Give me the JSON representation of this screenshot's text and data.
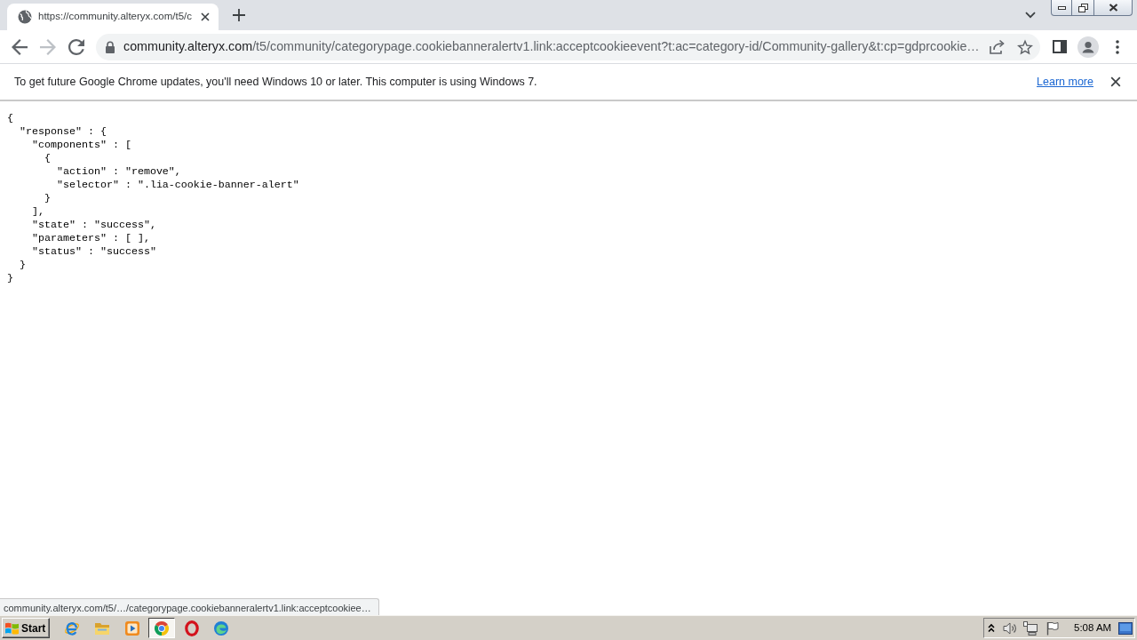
{
  "tabs": [
    {
      "title": "https://community.alteryx.com/t5/c",
      "selected": true
    }
  ],
  "nav_buttons": [
    {
      "kind": "back",
      "disabled": false
    },
    {
      "kind": "forward",
      "disabled": true
    },
    {
      "kind": "reload",
      "disabled": false
    }
  ],
  "address_bar": {
    "host": "community.alteryx.com",
    "path": "/t5/community/categorypage.cookiebanneralertv1.link:acceptcookieevent?t:ac=category-id/Community-gallery&t:cp=gdprcookie…"
  },
  "infobar": {
    "message": "To get future Google Chrome updates, you'll need Windows 10 or later. This computer is using Windows 7.",
    "link": "Learn more"
  },
  "page": {
    "text": "{\n  \"response\" : {\n    \"components\" : [\n      {\n        \"action\" : \"remove\",\n        \"selector\" : \".lia-cookie-banner-alert\"\n      }\n    ],\n    \"state\" : \"success\",\n    \"parameters\" : [ ],\n    \"status\" : \"success\"\n  }\n}"
  },
  "status_bubble": {
    "text": "community.alteryx.com/t5/…/categorypage.cookiebanneralertv1.link:acceptcookiee…"
  },
  "taskbar": {
    "start_label": "Start",
    "apps": [
      {
        "kind": "ie",
        "active": false
      },
      {
        "kind": "explorer",
        "active": false
      },
      {
        "kind": "media",
        "active": false
      },
      {
        "kind": "chrome",
        "active": true
      },
      {
        "kind": "opera",
        "active": false
      },
      {
        "kind": "edge",
        "active": false
      }
    ],
    "clock": "5:08 AM"
  }
}
